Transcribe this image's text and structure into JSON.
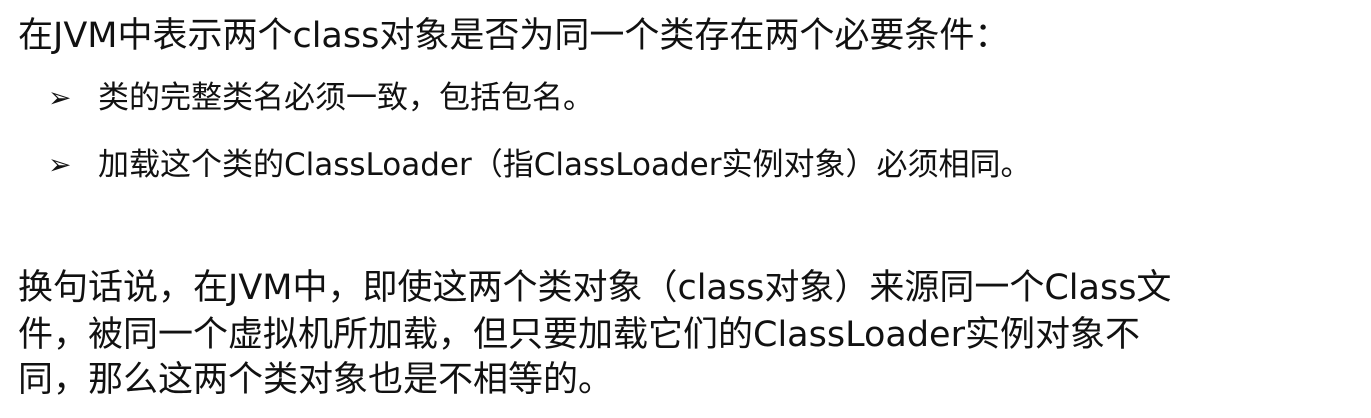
{
  "document": {
    "intro": "在JVM中表示两个class对象是否为同一个类存在两个必要条件：",
    "bullets": [
      {
        "marker": "➢",
        "text": "类的完整类名必须一致，包括包名。"
      },
      {
        "marker": "➢",
        "text": "加载这个类的ClassLoader（指ClassLoader实例对象）必须相同。"
      }
    ],
    "paragraph_lines": [
      "换句话说，在JVM中，即使这两个类对象（class对象）来源同一个Class文",
      "件，被同一个虚拟机所加载，但只要加载它们的ClassLoader实例对象不",
      "同，那么这两个类对象也是不相等的。"
    ]
  }
}
